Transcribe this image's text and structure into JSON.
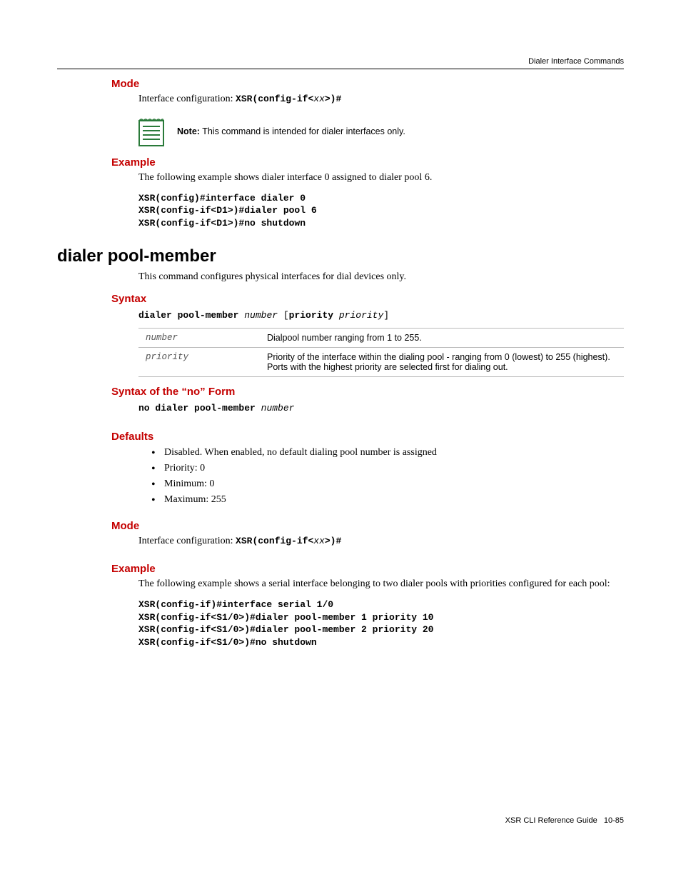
{
  "header": {
    "section": "Dialer Interface Commands"
  },
  "s1": {
    "mode_title": "Mode",
    "mode_text_pre": "Interface configuration: ",
    "mode_code_prefix": "XSR(config-if<",
    "mode_code_xx": "xx",
    "mode_code_suffix": ">)#",
    "note_prefix": "Note:",
    "note_text": " This command is intended for dialer interfaces only.",
    "example_title": "Example",
    "example_text": "The following example shows dialer interface 0 assigned to dialer pool 6.",
    "example_code": "XSR(config)#interface dialer 0\nXSR(config-if<D1>)#dialer pool 6\nXSR(config-if<D1>)#no shutdown"
  },
  "cmd": {
    "title": "dialer pool-member",
    "desc": "This command configures physical interfaces for dial devices only."
  },
  "syntax": {
    "title": "Syntax",
    "kw1": "dialer pool-member ",
    "arg1": "number",
    "bracket_open": " [",
    "kw2": "priority ",
    "arg2": "priority",
    "bracket_close": "]",
    "param1_name": "number",
    "param1_desc": "Dialpool number ranging from 1 to 255.",
    "param2_name": "priority",
    "param2_desc": "Priority of the interface within the dialing pool - ranging from 0 (lowest) to 255 (highest). Ports with the highest priority are selected first for dialing out."
  },
  "no_form": {
    "title": "Syntax of the “no” Form",
    "kw": "no dialer pool-member ",
    "arg": "number"
  },
  "defaults": {
    "title": "Defaults",
    "items": [
      "Disabled. When enabled, no default dialing pool number is assigned",
      "Priority: 0",
      "Minimum: 0",
      "Maximum: 255"
    ]
  },
  "s2": {
    "mode_title": "Mode",
    "mode_text_pre": "Interface configuration: ",
    "mode_code_prefix": "XSR(config-if<",
    "mode_code_xx": "xx",
    "mode_code_suffix": ">)#",
    "example_title": "Example",
    "example_text": "The following example shows a serial interface belonging to two dialer pools with priorities configured for each pool:",
    "example_code": "XSR(config-if)#interface serial 1/0\nXSR(config-if<S1/0>)#dialer pool-member 1 priority 10\nXSR(config-if<S1/0>)#dialer pool-member 2 priority 20\nXSR(config-if<S1/0>)#no shutdown"
  },
  "footer": {
    "guide": "XSR CLI Reference Guide",
    "page": "10-85"
  }
}
